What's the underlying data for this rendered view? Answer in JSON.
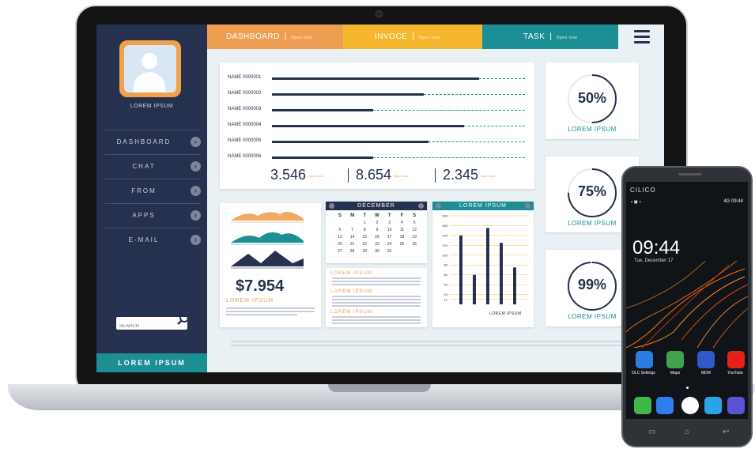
{
  "dashboard": {
    "tabs": [
      {
        "label": "DASHBOARD",
        "sub": "Open now",
        "color": "#ee9e52"
      },
      {
        "label": "INVOCE",
        "sub": "Open now",
        "color": "#f5b72d"
      },
      {
        "label": "TASK",
        "sub": "Open now",
        "color": "#1b8f94"
      }
    ],
    "menu_icon": "hamburger-icon",
    "sidebar": {
      "profile_name": "LOREM IPSUM",
      "nav": [
        "DASHBOARD",
        "CHAT",
        "FROM",
        "APPS",
        "E-MAIL"
      ],
      "search_placeholder": "SEARCH",
      "footer": "LOREM IPSUM",
      "bg_color": "#26314f"
    },
    "bars_card": {
      "rows": [
        {
          "label": "NAME 0000001",
          "progress": 0.82
        },
        {
          "label": "NAME 0000002",
          "progress": 0.6
        },
        {
          "label": "NAME 0000003",
          "progress": 0.4
        },
        {
          "label": "NAME 0000004",
          "progress": 0.76
        },
        {
          "label": "NAME 0000005",
          "progress": 0.62
        },
        {
          "label": "NAME 0000006",
          "progress": 0.4
        }
      ],
      "stats": [
        {
          "value": "3.546",
          "sub": "Open now"
        },
        {
          "value": "8.654",
          "sub": "Open now"
        },
        {
          "value": "2.345",
          "sub": "Open now"
        }
      ]
    },
    "money_card": {
      "amount": "$7.954",
      "title": "LOREM IPSUM"
    },
    "calendar": {
      "month": "DECEMBER",
      "day_headers": [
        "S",
        "M",
        "T",
        "W",
        "T",
        "F",
        "S"
      ],
      "days": [
        "",
        "",
        "1",
        "2",
        "3",
        "4",
        "5",
        "6",
        "7",
        "8",
        "9",
        "10",
        "11",
        "12",
        "13",
        "14",
        "15",
        "16",
        "17",
        "18",
        "19",
        "20",
        "21",
        "22",
        "23",
        "24",
        "25",
        "26",
        "27",
        "28",
        "29",
        "30",
        "31",
        "",
        ""
      ]
    },
    "text_card": {
      "titles": [
        "LOREM IPSUM",
        "LOREM IPSUM",
        "LOREM IPSUM"
      ]
    },
    "chart_card": {
      "title": "LOREM IPSUM",
      "axis_label": "LOREM IPSUM"
    },
    "percent_cards": [
      {
        "value": "50%",
        "label": "LOREM IPSUM",
        "fraction": 0.5
      },
      {
        "value": "75%",
        "label": "LOREM IPSUM",
        "fraction": 0.75
      },
      {
        "value": "99%",
        "label": "LOREM IPSUM",
        "fraction": 0.99
      }
    ]
  },
  "chart_data": {
    "type": "bar",
    "categories": [
      "1",
      "2",
      "3",
      "4",
      "5",
      "6"
    ],
    "values": [
      140,
      60,
      155,
      125,
      75,
      0
    ],
    "ylim": [
      0,
      180
    ],
    "yticks": [
      "180",
      "160",
      "140",
      "120",
      "100",
      "80",
      "60",
      "40",
      "20",
      "10"
    ],
    "grid": true
  },
  "phone": {
    "brand": "CILICO",
    "status_right": "4G 09:44",
    "time": "09:44",
    "date": "Tue, December 17",
    "apps_row1": [
      {
        "name": "DLC Settings",
        "color": "#2b7de0"
      },
      {
        "name": "Maps",
        "color": "#3fa34d"
      },
      {
        "name": "MDM",
        "color": "#2d59c9"
      },
      {
        "name": "YouTube",
        "color": "#e62117"
      }
    ],
    "dock": [
      {
        "name": "phone",
        "color": "#43b649"
      },
      {
        "name": "messages",
        "color": "#2d7ff0"
      },
      {
        "name": "apps",
        "color": "#ffffff"
      },
      {
        "name": "settings",
        "color": "#2aa3e8"
      },
      {
        "name": "browser",
        "color": "#5b53d6"
      }
    ]
  }
}
